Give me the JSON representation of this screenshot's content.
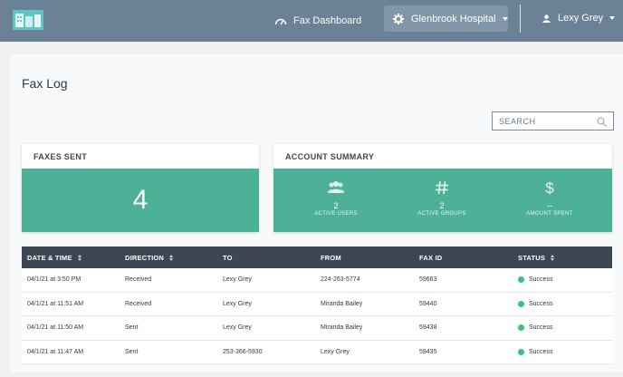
{
  "nav": {
    "dashboard_label": "Fax Dashboard",
    "hospital_label": "Glenbrook Hospital",
    "user_label": "Lexy Grey"
  },
  "page": {
    "title": "Fax Log"
  },
  "search": {
    "placeholder": "SEARCH"
  },
  "faxes_sent": {
    "header": "FAXES SENT",
    "value": "4"
  },
  "account_summary": {
    "header": "ACCOUNT SUMMARY",
    "stats": [
      {
        "value": "2",
        "label": "ACTIVE USERS",
        "icon": "users-icon"
      },
      {
        "value": "2",
        "label": "ACTIVE GROUPS",
        "icon": "hash-icon"
      },
      {
        "value": "--",
        "label": "AMOUNT SPENT",
        "icon": "dollar-icon"
      }
    ]
  },
  "table": {
    "columns": [
      "DATE & TIME",
      "DIRECTION",
      "TO",
      "FROM",
      "FAX ID",
      "STATUS"
    ],
    "rows": [
      {
        "date": "04/1/21 at 3:50 PM",
        "direction": "Received",
        "to": "Lexy Grey",
        "from": "224-263-5774",
        "fax_id": "59663",
        "status": "Success"
      },
      {
        "date": "04/1/21 at 11:51 AM",
        "direction": "Received",
        "to": "Lexy Grey",
        "from": "Miranda Bailey",
        "fax_id": "59440",
        "status": "Success"
      },
      {
        "date": "04/1/21 at 11:50 AM",
        "direction": "Sent",
        "to": "Lexy Grey",
        "from": "Miranda Bailey",
        "fax_id": "59438",
        "status": "Success"
      },
      {
        "date": "04/1/21 at 11:47 AM",
        "direction": "Sent",
        "to": "253-366-5930",
        "from": "Lexy Grey",
        "fax_id": "59435",
        "status": "Success"
      }
    ]
  },
  "colors": {
    "topbar": "#6b8296",
    "card_accent": "#4db198",
    "table_header": "#3c4753",
    "status_success": "#2ecc71"
  }
}
